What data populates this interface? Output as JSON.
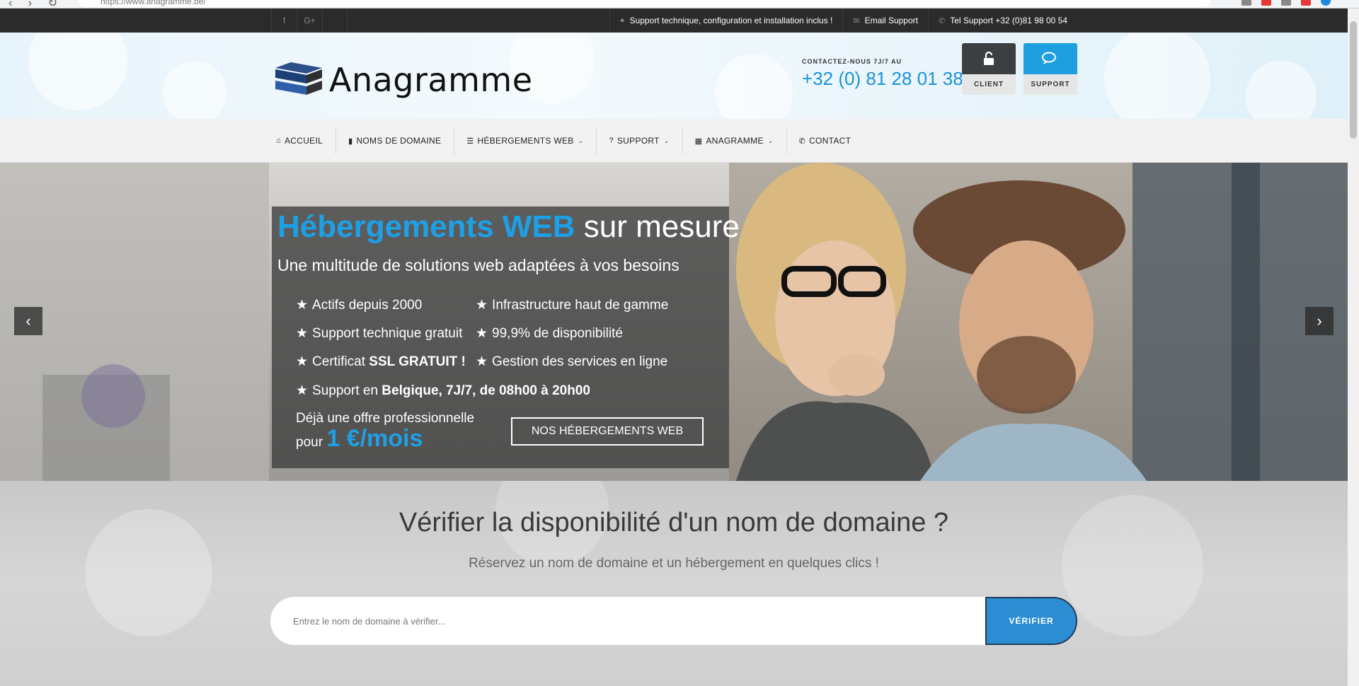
{
  "browser": {
    "url": "https://www.anagramme.be/"
  },
  "topbar": {
    "social": [
      "f",
      "G+"
    ],
    "support_info": "Support technique, configuration et installation inclus !",
    "email_support": "Email Support",
    "tel_support": "Tel Support +32 (0)81 98 00 54"
  },
  "header": {
    "logo_text": "Anagramme",
    "contact_label": "CONTACTEZ-NOUS 7J/7 AU",
    "phone": "+32 (0) 81 28 01 38",
    "client_button": "CLIENT",
    "support_button": "SUPPORT"
  },
  "nav": {
    "items": [
      {
        "label": "ACCUEIL",
        "icon": "home-icon",
        "dropdown": false
      },
      {
        "label": "NOMS DE DOMAINE",
        "icon": "bookmark-icon",
        "dropdown": false
      },
      {
        "label": "HÉBERGEMENTS WEB",
        "icon": "list-icon",
        "dropdown": true
      },
      {
        "label": "SUPPORT",
        "icon": "question-circle-icon",
        "dropdown": true
      },
      {
        "label": "ANAGRAMME",
        "icon": "building-icon",
        "dropdown": true
      },
      {
        "label": "CONTACT",
        "icon": "phone-icon",
        "dropdown": false
      }
    ]
  },
  "hero": {
    "title_highlight": "Hébergements WEB",
    "title_rest": " sur mesure",
    "subtitle": "Une multitude de solutions web adaptées à vos besoins",
    "features": [
      {
        "text": "Actifs depuis 2000"
      },
      {
        "text": "Infrastructure haut de gamme"
      },
      {
        "text": "Support technique gratuit"
      },
      {
        "text": "99,9% de disponibilité"
      },
      {
        "text_before": "Certificat ",
        "text_bold": "SSL GRATUIT !"
      },
      {
        "text": "Gestion des services en ligne"
      },
      {
        "text_before": "Support en ",
        "text_bold": "Belgique, 7J/7, de 08h00 à 20h00"
      }
    ],
    "offer_line1": "Déjà une offre professionnelle",
    "offer_pour": "pour",
    "offer_price": "1 €/mois",
    "cta": "NOS HÉBERGEMENTS WEB"
  },
  "domain": {
    "title": "Vérifier la disponibilité d'un nom de domaine ?",
    "subtitle": "Réservez un nom de domaine et un hébergement en quelques clics !",
    "placeholder": "Entrez le nom de domaine à vérifier...",
    "button": "VÉRIFIER"
  },
  "colors": {
    "accent_blue": "#1ea0e6",
    "topbar_bg": "#2b2b2b",
    "verify_button": "#2d8dd3"
  }
}
